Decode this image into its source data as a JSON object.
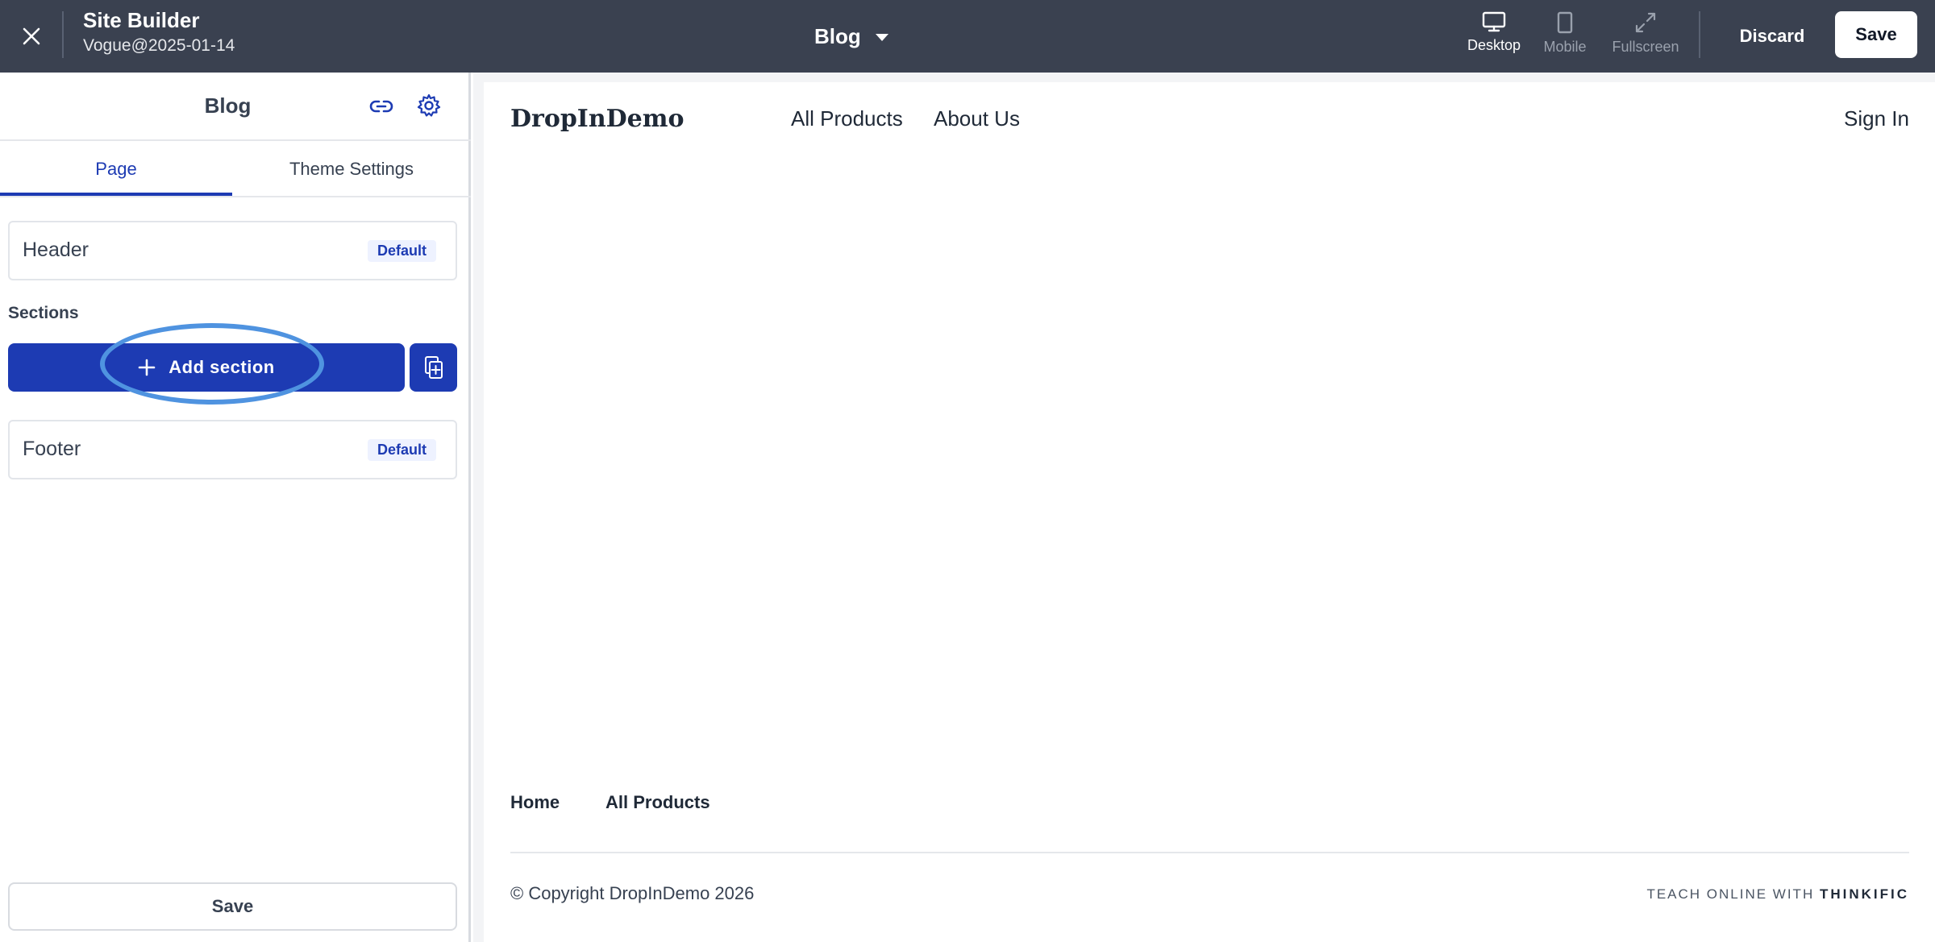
{
  "topbar": {
    "app_title": "Site Builder",
    "site_name": "Vogue@2025-01-14",
    "page_select": "Blog",
    "views": {
      "desktop": "Desktop",
      "mobile": "Mobile",
      "fullscreen": "Fullscreen"
    },
    "active_view": "desktop",
    "discard_label": "Discard",
    "save_label": "Save",
    "icons": [
      "close-icon",
      "caret-down-icon",
      "desktop-icon",
      "mobile-icon",
      "fullscreen-icon"
    ]
  },
  "sidebar": {
    "title": "Blog",
    "icons": [
      "link-icon",
      "gear-icon"
    ],
    "tabs": [
      {
        "label": "Page",
        "active": true
      },
      {
        "label": "Theme Settings",
        "active": false
      }
    ],
    "header_row": {
      "label": "Header",
      "badge": "Default"
    },
    "sections_label": "Sections",
    "add_section_label": "Add section",
    "footer_row": {
      "label": "Footer",
      "badge": "Default"
    },
    "save_label": "Save"
  },
  "preview": {
    "brand": "DropInDemo",
    "nav": [
      "All Products",
      "About Us"
    ],
    "sign_in": "Sign In",
    "footer_links": [
      "Home",
      "All Products"
    ],
    "copyright": "© Copyright DropInDemo 2026",
    "powered_prefix": "TEACH ONLINE WITH",
    "powered_brand": "THINKIFIC"
  },
  "colors": {
    "topbar_bg": "#3a4150",
    "accent": "#1d3bb3",
    "highlight_ring": "#4f93e0",
    "badge_bg": "#eef2ff"
  }
}
